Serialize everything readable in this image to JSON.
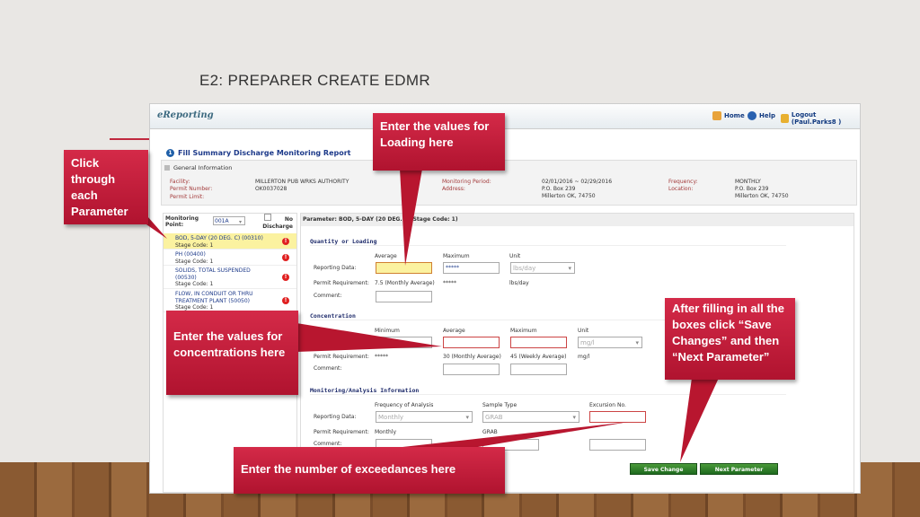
{
  "slide": {
    "title": "E2: PREPARER CREATE EDMR"
  },
  "app": {
    "logo": "eReporting",
    "nav": {
      "home": "Home",
      "help": "Help",
      "logout": "Logout (Paul.Parks8 )"
    },
    "page_title": "Fill Summary Discharge Monitoring Report",
    "general": {
      "header": "General Information",
      "facility_label": "Facility:",
      "facility": "MILLERTON PUB WRKS AUTHORITY",
      "permit_number_label": "Permit Number:",
      "permit_number": "OK0037028",
      "permit_limit_label": "Permit Limit:",
      "period_label": "Monitoring Period:",
      "period": "02/01/2016 ~ 02/29/2016",
      "address_label": "Address:",
      "address1": "P.O. Box 239",
      "address2": "Millerton OK, 74750",
      "frequency_label": "Frequency:",
      "frequency": "MONTHLY",
      "location_label": "Location:",
      "location1": "P.O. Box 239",
      "location2": "Millerton OK, 74750"
    },
    "left": {
      "mp_label": "Monitoring Point:",
      "mp_value": "001A",
      "no_discharge": "No Discharge",
      "params": [
        {
          "name": "BOD, 5-DAY (20 DEG. C) (00310)",
          "stage": "Stage Code: 1"
        },
        {
          "name": "PH (00400)",
          "stage": "Stage Code: 1"
        },
        {
          "name": "SOLIDS, TOTAL SUSPENDED (00530)",
          "stage": "Stage Code: 1"
        },
        {
          "name": "FLOW, IN CONDUIT OR THRU TREATMENT PLANT (50050)",
          "stage": "Stage Code: 1"
        }
      ]
    },
    "right": {
      "param_header": "Parameter: BOD, 5-DAY (20 DEG. C)(Stage Code: 1)",
      "qty": {
        "title": "Quantity or Loading",
        "avg": "Average",
        "max": "Maximum",
        "unit": "Unit",
        "rep": "Reporting Data:",
        "max_value": "*****",
        "unit_value": "lbs/day",
        "preq": "Permit Requirement:",
        "preq_avg": "7.5 (Monthly Average)",
        "preq_max": "*****",
        "preq_unit": "lbs/day",
        "comment": "Comment:"
      },
      "conc": {
        "title": "Concentration",
        "min": "Minimum",
        "avg": "Average",
        "max": "Maximum",
        "unit": "Unit",
        "unit_value": "mg/l",
        "preq": "Permit Requirement:",
        "preq_min": "*****",
        "preq_avg": "30 (Monthly Average)",
        "preq_max": "45 (Weekly Average)",
        "preq_unit": "mg/l",
        "comment": "Comment:"
      },
      "mon": {
        "title": "Monitoring/Analysis Information",
        "freq": "Frequency of Analysis",
        "stype": "Sample Type",
        "exc": "Excursion No.",
        "rep": "Reporting Data:",
        "freq_value": "Monthly",
        "stype_value": "GRAB",
        "preq": "Permit Requirement:",
        "preq_freq": "Monthly",
        "preq_stype": "GRAB",
        "comment": "Comment:"
      },
      "save": "Save Change",
      "next": "Next Parameter"
    }
  },
  "callouts": {
    "loading": "Enter the values for Loading here",
    "params": "Click through each Parameter",
    "conc": "Enter the values for concentrations here",
    "save": "After filling in all the boxes click “Save Changes” and then “Next Parameter”",
    "exc": "Enter the number of exceedances here"
  },
  "colors": {
    "callout": "#c41e3a",
    "save_button": "#2e7d2e",
    "highlight": "#fbf2a0"
  }
}
